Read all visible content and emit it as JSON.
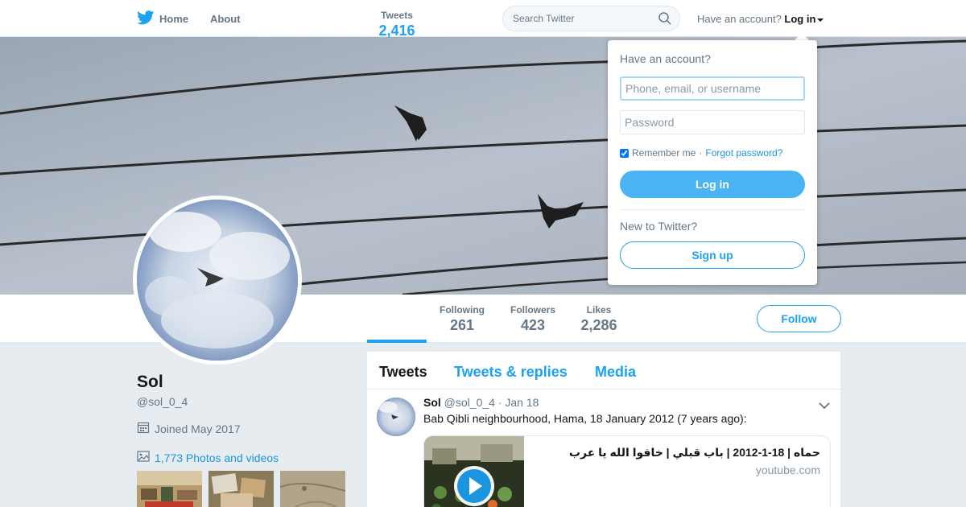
{
  "nav": {
    "home_label": "Home",
    "about_label": "About",
    "search_placeholder": "Search Twitter",
    "have_account": "Have an account?",
    "login_label": "Log in"
  },
  "profile": {
    "name": "Sol",
    "handle": "@sol_0_4",
    "joined": "Joined May 2017",
    "photos_link": "1,773 Photos and videos"
  },
  "stats": [
    {
      "label": "Tweets",
      "value": "2,416"
    },
    {
      "label": "Following",
      "value": "261"
    },
    {
      "label": "Followers",
      "value": "423"
    },
    {
      "label": "Likes",
      "value": "2,286"
    }
  ],
  "follow_label": "Follow",
  "tabs": [
    "Tweets",
    "Tweets & replies",
    "Media"
  ],
  "tweet": {
    "name": "Sol",
    "handle": "@sol_0_4",
    "separator": "·",
    "date": "Jan 18",
    "text": "Bab Qibli neighbourhood, Hama, 18 January 2012 (7 years ago):",
    "card_title": "حماه | 18-1-2012 | باب قبلي | خافوا الله يا عرب",
    "card_domain": "youtube.com"
  },
  "login_dropdown": {
    "heading": "Have an account?",
    "username_placeholder": "Phone, email, or username",
    "password_placeholder": "Password",
    "remember_label": "Remember me",
    "separator": "·",
    "forgot_label": "Forgot password?",
    "login_button": "Log in",
    "new_heading": "New to Twitter?",
    "signup_button": "Sign up"
  },
  "colors": {
    "accent": "#1da1f2",
    "link": "#1b95e0",
    "login_button": "#4ab3f4"
  },
  "icons": [
    "twitter-bird-icon",
    "search-icon",
    "calendar-icon",
    "photo-icon",
    "chevron-down-icon",
    "play-icon"
  ]
}
